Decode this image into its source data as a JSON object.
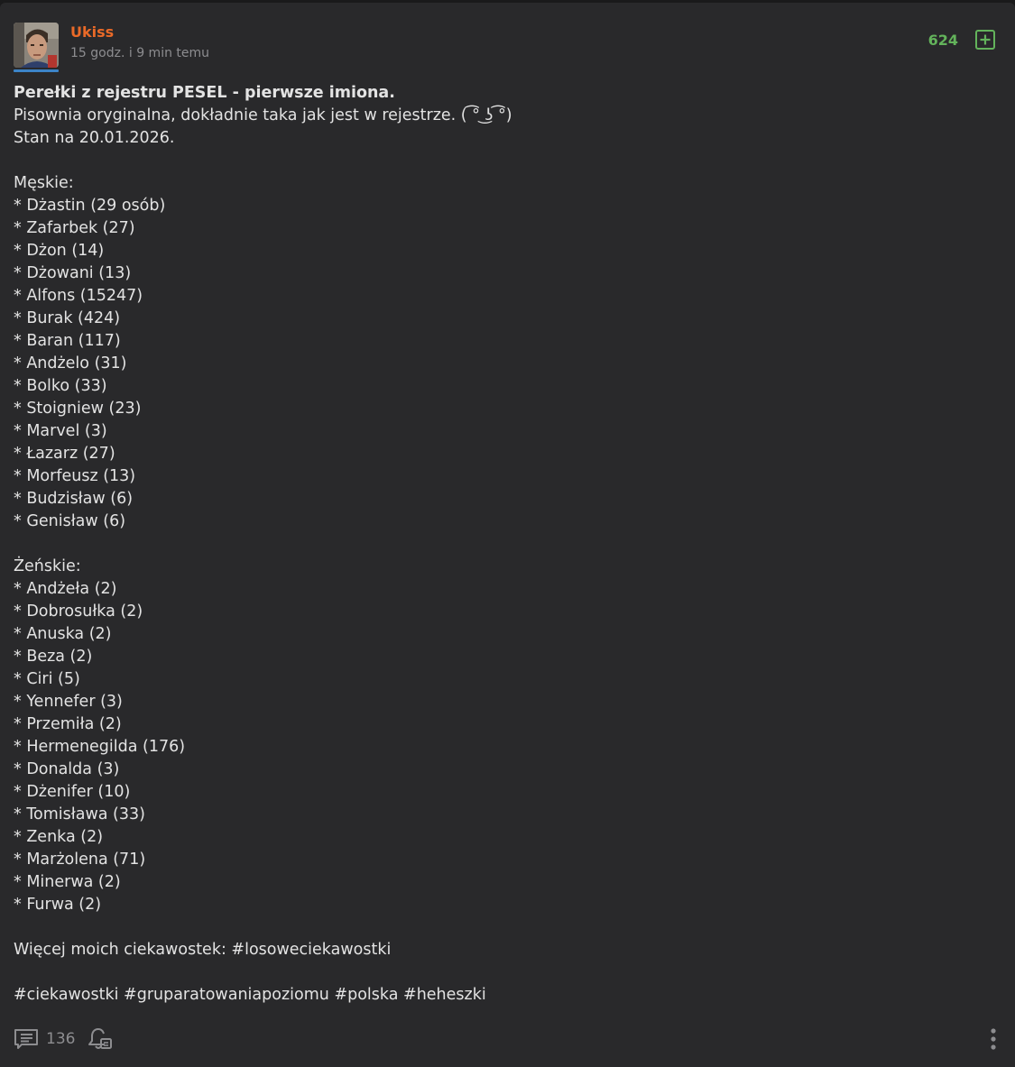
{
  "post": {
    "author": "Ukiss",
    "time": "15 godz. i 9 min temu",
    "votes": "624",
    "icons": {
      "plus": "plus-square-icon",
      "comments": "comments-icon",
      "bell": "bell-icon",
      "more": "more-vertical-icon"
    },
    "colors": {
      "username": "#ea6a28",
      "votes": "#63b35b",
      "avatar_bar": "#3c84c8",
      "background": "#29292b"
    },
    "title": "Perełki z rejestru PESEL - pierwsze imiona.",
    "intro_line": "Pisownia oryginalna, dokładnie taka jak jest w rejestrze. ( ͡° ͜ʖ ͡°)",
    "date_line": "Stan na 20.01.2026.",
    "male_header": "Męskie:",
    "male_names": [
      "* Dżastin (29 osób)",
      "* Zafarbek (27)",
      "* Dżon (14)",
      "* Dżowani (13)",
      "* Alfons (15247)",
      "* Burak (424)",
      "* Baran (117)",
      "* Andżelo (31)",
      "* Bolko (33)",
      "* Stoigniew (23)",
      "* Marvel (3)",
      "* Łazarz (27)",
      "* Morfeusz (13)",
      "* Budzisław (6)",
      "* Genisław (6)"
    ],
    "female_header": "Żeńskie:",
    "female_names": [
      "* Andżeła (2)",
      "* Dobrosułka (2)",
      "* Anuska (2)",
      "* Beza (2)",
      "* Ciri (5)",
      "* Yennefer (3)",
      "* Przemiła (2)",
      "* Hermenegilda (176)",
      "* Donalda (3)",
      "* Dżenifer (10)",
      "* Tomisława (33)",
      "* Zenka (2)",
      "* Marżolena (71)",
      "* Minerwa (2)",
      "* Furwa (2)"
    ],
    "more_text": "Więcej moich ciekawostek: ",
    "more_tag": "#losoweciekawostki",
    "tags": [
      "#ciekawostki",
      "#gruparatowaniapoziomu",
      "#polska",
      "#heheszki"
    ],
    "comments_count": "136"
  }
}
